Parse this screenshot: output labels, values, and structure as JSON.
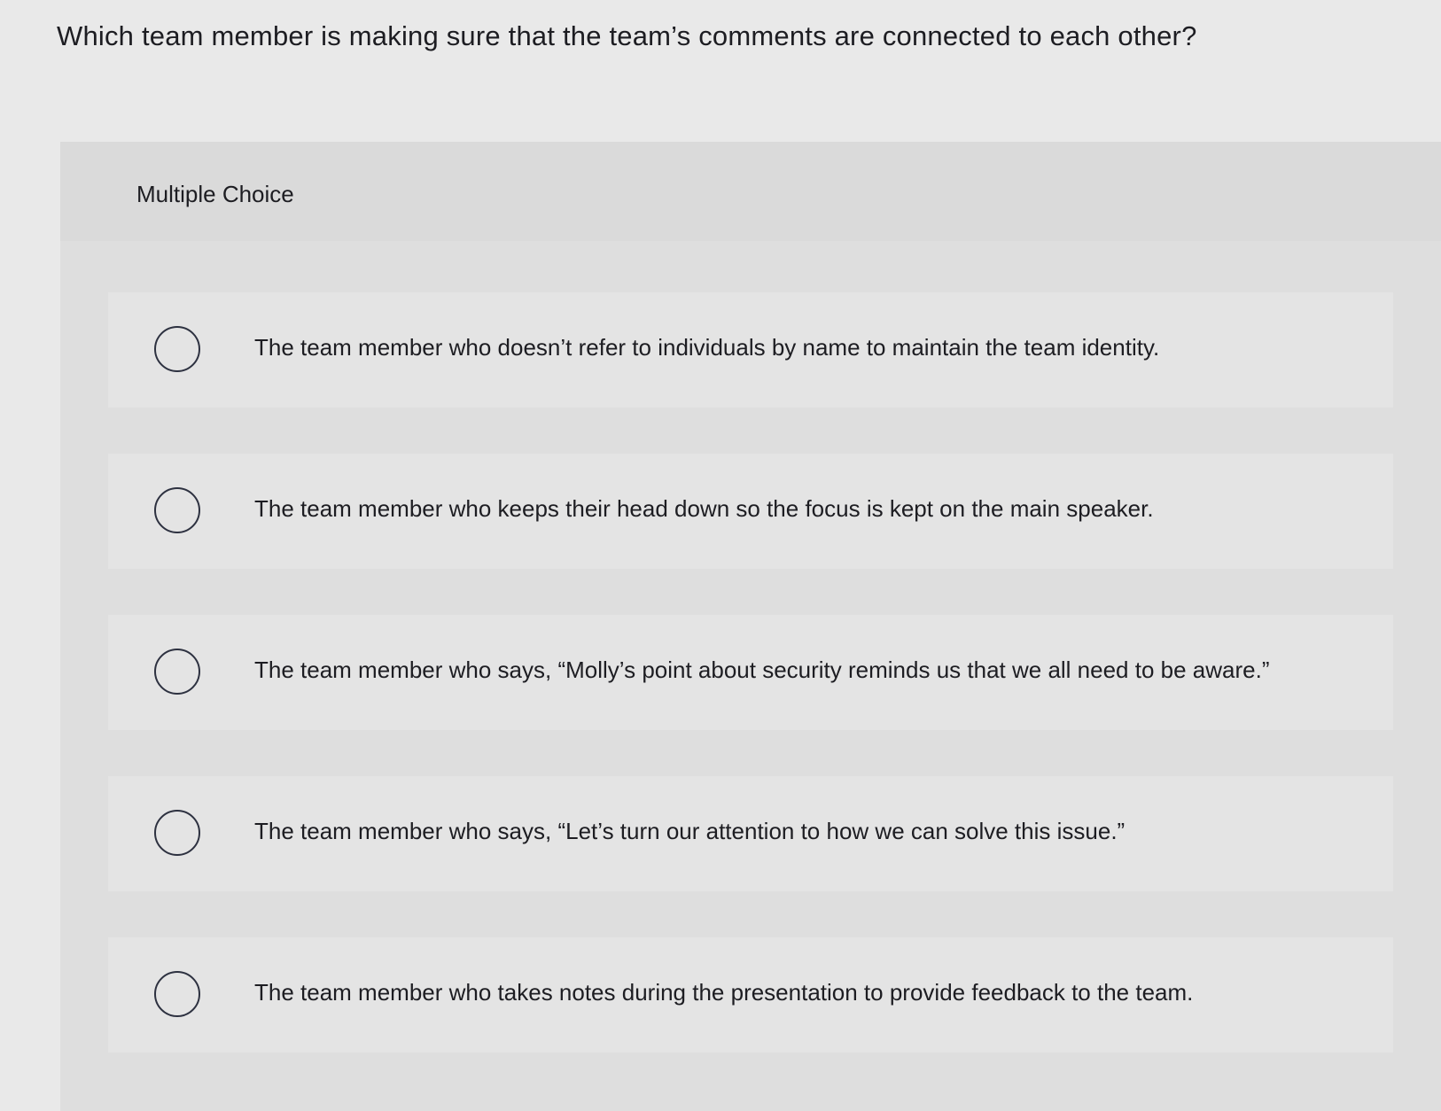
{
  "question": {
    "text": "Which team member is making sure that the team’s comments are connected to each other?"
  },
  "panel": {
    "type_label": "Multiple Choice"
  },
  "choices": [
    {
      "label": "The team member who doesn’t refer to individuals by name to maintain the team identity."
    },
    {
      "label": "The team member who keeps their head down so the focus is kept on the main speaker."
    },
    {
      "label": "The team member who says, “Molly’s point about security reminds us that we all need to be aware.”"
    },
    {
      "label": "The team member who says, “Let’s turn our attention to how we can solve this issue.”"
    },
    {
      "label": "The team member who takes notes during the presentation to provide feedback to the team."
    }
  ]
}
